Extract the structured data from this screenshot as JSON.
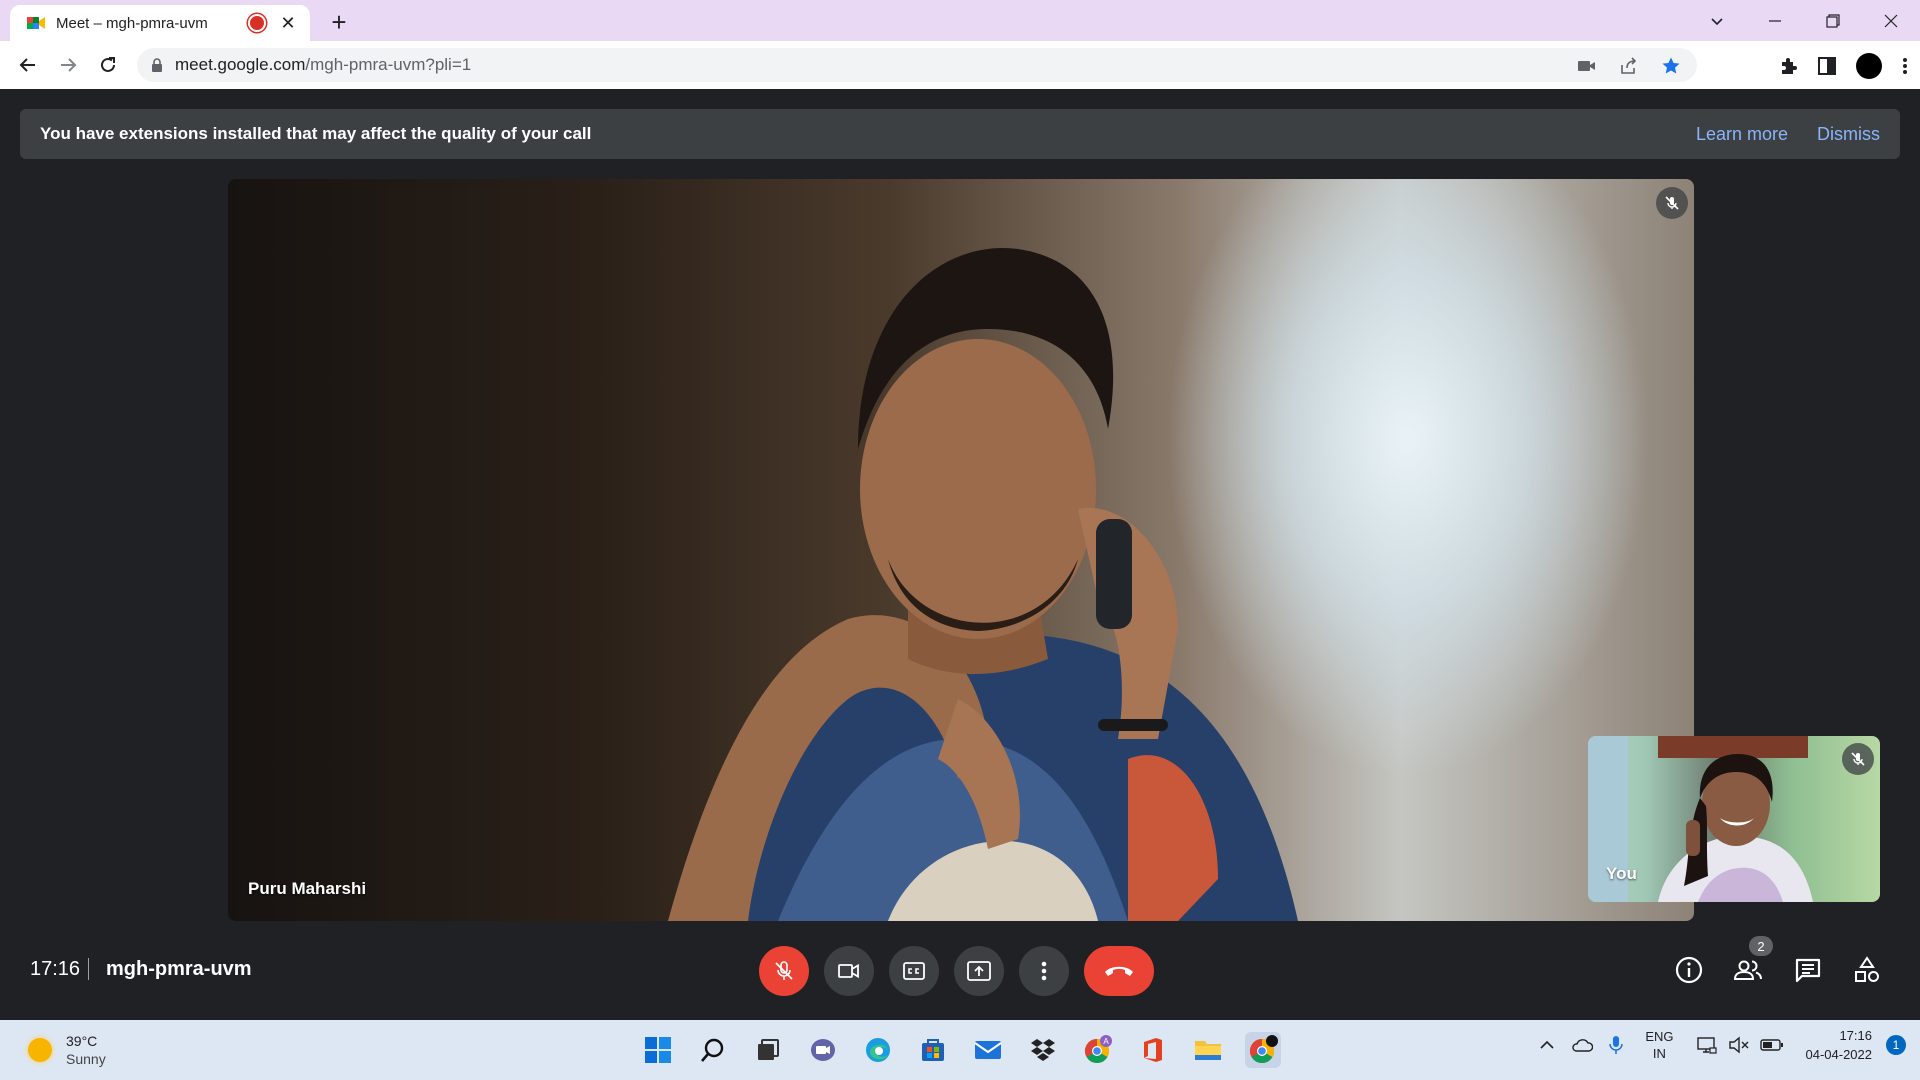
{
  "browser": {
    "tab_title": "Meet – mgh-pmra-uvm",
    "url_host": "meet.google.com",
    "url_path": "/mgh-pmra-uvm?pli=1"
  },
  "banner": {
    "message": "You have extensions installed that may affect the quality of your call",
    "learn_more": "Learn more",
    "dismiss": "Dismiss"
  },
  "main_tile": {
    "participant_name": "Puru Maharshi",
    "muted": true
  },
  "self_tile": {
    "label": "You",
    "muted": true
  },
  "bottom_bar": {
    "time": "17:16",
    "meeting_code": "mgh-pmra-uvm",
    "people_count": "2"
  },
  "taskbar": {
    "temperature": "39°C",
    "weather": "Sunny",
    "lang_top": "ENG",
    "lang_bottom": "IN",
    "clock_time": "17:16",
    "clock_date": "04-04-2022",
    "notification_count": "1"
  },
  "colors": {
    "meet_bg": "#202124",
    "banner_bg": "#3c4043",
    "link": "#8ab4f8",
    "danger": "#ea4335",
    "tabstrip": "#e9d9f5",
    "taskbar": "#dde6f3"
  }
}
